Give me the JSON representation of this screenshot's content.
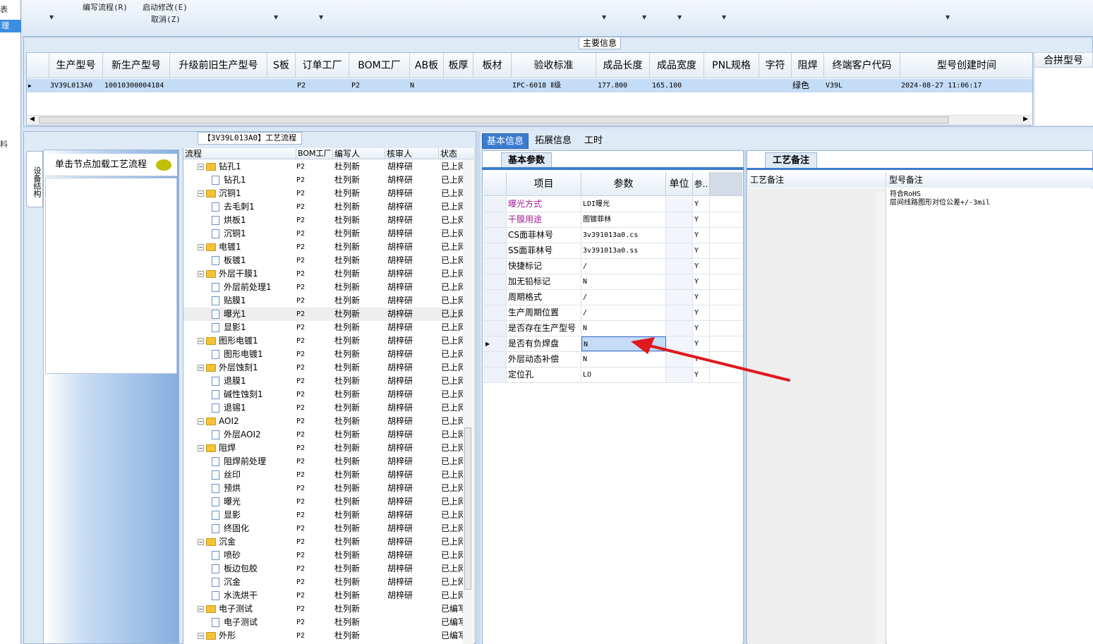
{
  "left_strip": {
    "item_top": "表",
    "item_selected": "理",
    "item_lower": "料"
  },
  "toolbar": {
    "edit_flow": "编写流程(R)",
    "start_modify": "启动修改(E)",
    "cancel": "取消(Z)"
  },
  "main_info": {
    "title": "主要信息",
    "columns": [
      "生产型号",
      "新生产型号",
      "升级前旧生产型号",
      "S板",
      "订单工厂",
      "BOM工厂",
      "AB板",
      "板厚",
      "板材",
      "验收标准",
      "成品长度",
      "成品宽度",
      "PNL规格",
      "字符",
      "阻焊",
      "终端客户代码",
      "型号创建时间"
    ],
    "row": {
      "prod_model": "3V39L013A0",
      "new_prod_model": "10010300004184",
      "old_model": "",
      "s_board": "",
      "order_factory": "P2",
      "bom_factory": "P2",
      "ab_board": "N",
      "thickness": "",
      "material": "",
      "standard": "IPC-6018 Ⅱ级",
      "length": "177.800",
      "width": "165.100",
      "pnl": "",
      "character": "",
      "solder_mask": "绿色",
      "customer_code": "V39L",
      "created": "2024-08-27 11:06:17"
    },
    "merge_header": "合拼型号"
  },
  "flow_panel": {
    "title": "【3V39L013A0】工艺流程",
    "vertical_tab": "设备结构",
    "load_hint": "单击节点加载工艺流程",
    "columns": [
      "流程",
      "BOM工厂",
      "编写人",
      "核审人",
      "状态"
    ],
    "rows": [
      {
        "name": "钻孔1",
        "level": 0,
        "bom": "P2",
        "writer": "杜列新",
        "reviewer": "胡梓研",
        "status": "已上网"
      },
      {
        "name": "钻孔1",
        "level": 1,
        "bom": "P2",
        "writer": "杜列新",
        "reviewer": "胡梓研",
        "status": "已上网"
      },
      {
        "name": "沉铜1",
        "level": 0,
        "bom": "P2",
        "writer": "杜列新",
        "reviewer": "胡梓研",
        "status": "已上网"
      },
      {
        "name": "去毛刺1",
        "level": 1,
        "bom": "P2",
        "writer": "杜列新",
        "reviewer": "胡梓研",
        "status": "已上网"
      },
      {
        "name": "烘板1",
        "level": 1,
        "bom": "P2",
        "writer": "杜列新",
        "reviewer": "胡梓研",
        "status": "已上网"
      },
      {
        "name": "沉铜1",
        "level": 1,
        "bom": "P2",
        "writer": "杜列新",
        "reviewer": "胡梓研",
        "status": "已上网"
      },
      {
        "name": "电镀1",
        "level": 0,
        "bom": "P2",
        "writer": "杜列新",
        "reviewer": "胡梓研",
        "status": "已上网"
      },
      {
        "name": "板镀1",
        "level": 1,
        "bom": "P2",
        "writer": "杜列新",
        "reviewer": "胡梓研",
        "status": "已上网"
      },
      {
        "name": "外层干膜1",
        "level": 0,
        "bom": "P2",
        "writer": "杜列新",
        "reviewer": "胡梓研",
        "status": "已上网"
      },
      {
        "name": "外层前处理1",
        "level": 1,
        "bom": "P2",
        "writer": "杜列新",
        "reviewer": "胡梓研",
        "status": "已上网"
      },
      {
        "name": "贴膜1",
        "level": 1,
        "bom": "P2",
        "writer": "杜列新",
        "reviewer": "胡梓研",
        "status": "已上网"
      },
      {
        "name": "曝光1",
        "level": 1,
        "bom": "P2",
        "writer": "杜列新",
        "reviewer": "胡梓研",
        "status": "已上网"
      },
      {
        "name": "显影1",
        "level": 1,
        "bom": "P2",
        "writer": "杜列新",
        "reviewer": "胡梓研",
        "status": "已上网"
      },
      {
        "name": "图形电镀1",
        "level": 0,
        "bom": "P2",
        "writer": "杜列新",
        "reviewer": "胡梓研",
        "status": "已上网"
      },
      {
        "name": "图形电镀1",
        "level": 1,
        "bom": "P2",
        "writer": "杜列新",
        "reviewer": "胡梓研",
        "status": "已上网"
      },
      {
        "name": "外层蚀刻1",
        "level": 0,
        "bom": "P2",
        "writer": "杜列新",
        "reviewer": "胡梓研",
        "status": "已上网"
      },
      {
        "name": "退膜1",
        "level": 1,
        "bom": "P2",
        "writer": "杜列新",
        "reviewer": "胡梓研",
        "status": "已上网"
      },
      {
        "name": "碱性蚀刻1",
        "level": 1,
        "bom": "P2",
        "writer": "杜列新",
        "reviewer": "胡梓研",
        "status": "已上网"
      },
      {
        "name": "退锡1",
        "level": 1,
        "bom": "P2",
        "writer": "杜列新",
        "reviewer": "胡梓研",
        "status": "已上网"
      },
      {
        "name": "AOI2",
        "level": 0,
        "bom": "P2",
        "writer": "杜列新",
        "reviewer": "胡梓研",
        "status": "已上网"
      },
      {
        "name": "外层AOI2",
        "level": 1,
        "bom": "P2",
        "writer": "杜列新",
        "reviewer": "胡梓研",
        "status": "已上网"
      },
      {
        "name": "阻焊",
        "level": 0,
        "bom": "P2",
        "writer": "杜列新",
        "reviewer": "胡梓研",
        "status": "已上网"
      },
      {
        "name": "阻焊前处理",
        "level": 1,
        "bom": "P2",
        "writer": "杜列新",
        "reviewer": "胡梓研",
        "status": "已上网"
      },
      {
        "name": "丝印",
        "level": 1,
        "bom": "P2",
        "writer": "杜列新",
        "reviewer": "胡梓研",
        "status": "已上网"
      },
      {
        "name": "预烘",
        "level": 1,
        "bom": "P2",
        "writer": "杜列新",
        "reviewer": "胡梓研",
        "status": "已上网"
      },
      {
        "name": "曝光",
        "level": 1,
        "bom": "P2",
        "writer": "杜列新",
        "reviewer": "胡梓研",
        "status": "已上网"
      },
      {
        "name": "显影",
        "level": 1,
        "bom": "P2",
        "writer": "杜列新",
        "reviewer": "胡梓研",
        "status": "已上网"
      },
      {
        "name": "终固化",
        "level": 1,
        "bom": "P2",
        "writer": "杜列新",
        "reviewer": "胡梓研",
        "status": "已上网"
      },
      {
        "name": "沉金",
        "level": 0,
        "bom": "P2",
        "writer": "杜列新",
        "reviewer": "胡梓研",
        "status": "已上网"
      },
      {
        "name": "喷砂",
        "level": 1,
        "bom": "P2",
        "writer": "杜列新",
        "reviewer": "胡梓研",
        "status": "已上网"
      },
      {
        "name": "板边包胶",
        "level": 1,
        "bom": "P2",
        "writer": "杜列新",
        "reviewer": "胡梓研",
        "status": "已上网"
      },
      {
        "name": "沉金",
        "level": 1,
        "bom": "P2",
        "writer": "杜列新",
        "reviewer": "胡梓研",
        "status": "已上网"
      },
      {
        "name": "水洗烘干",
        "level": 1,
        "bom": "P2",
        "writer": "杜列新",
        "reviewer": "胡梓研",
        "status": "已上网"
      },
      {
        "name": "电子测试",
        "level": 0,
        "bom": "P2",
        "writer": "杜列新",
        "reviewer": "",
        "status": "已编写"
      },
      {
        "name": "电子测试",
        "level": 1,
        "bom": "P2",
        "writer": "杜列新",
        "reviewer": "",
        "status": "已编写"
      },
      {
        "name": "外形",
        "level": 0,
        "bom": "P2",
        "writer": "杜列新",
        "reviewer": "",
        "status": "已编写"
      }
    ]
  },
  "tabs": [
    "基本信息",
    "拓展信息",
    "工时"
  ],
  "basic_params": {
    "tab_label": "基本参数",
    "columns": [
      "项目",
      "参数",
      "单位",
      "参.."
    ],
    "rows": [
      {
        "name": "曝光方式",
        "value": "LDI曝光",
        "unit": "",
        "req": "Y",
        "pink": true
      },
      {
        "name": "干膜用途",
        "value": "图镀菲林",
        "unit": "",
        "req": "Y",
        "pink": true
      },
      {
        "name": "CS面菲林号",
        "value": "3v391013a0.cs",
        "unit": "",
        "req": "Y"
      },
      {
        "name": "SS面菲林号",
        "value": "3v391013a0.ss",
        "unit": "",
        "req": "Y"
      },
      {
        "name": "快捷标记",
        "value": "/",
        "unit": "",
        "req": "Y"
      },
      {
        "name": "加无铅标记",
        "value": "N",
        "unit": "",
        "req": "Y"
      },
      {
        "name": "周期格式",
        "value": "/",
        "unit": "",
        "req": "Y"
      },
      {
        "name": "生产周期位置",
        "value": "/",
        "unit": "",
        "req": "Y"
      },
      {
        "name": "是否存在生产型号",
        "value": "N",
        "unit": "",
        "req": "Y"
      },
      {
        "name": "是否有负焊盘",
        "value": "N",
        "unit": "",
        "req": "Y",
        "selected": true
      },
      {
        "name": "外层动态补偿",
        "value": "N",
        "unit": "",
        "req": "Y"
      },
      {
        "name": "定位孔",
        "value": "LO",
        "unit": "",
        "req": "Y"
      }
    ]
  },
  "remarks": {
    "tab_label": "工艺备注",
    "col1": "工艺备注",
    "col2": "型号备注",
    "model_remark_line1": "符合RoHS",
    "model_remark_line2": "层间线路图形对位公差+/-3mil"
  },
  "colors": {
    "accent": "#3c7cd0",
    "selection": "#c5dcf6",
    "arrow": "#e0191f",
    "pink_label": "#a0209a"
  }
}
